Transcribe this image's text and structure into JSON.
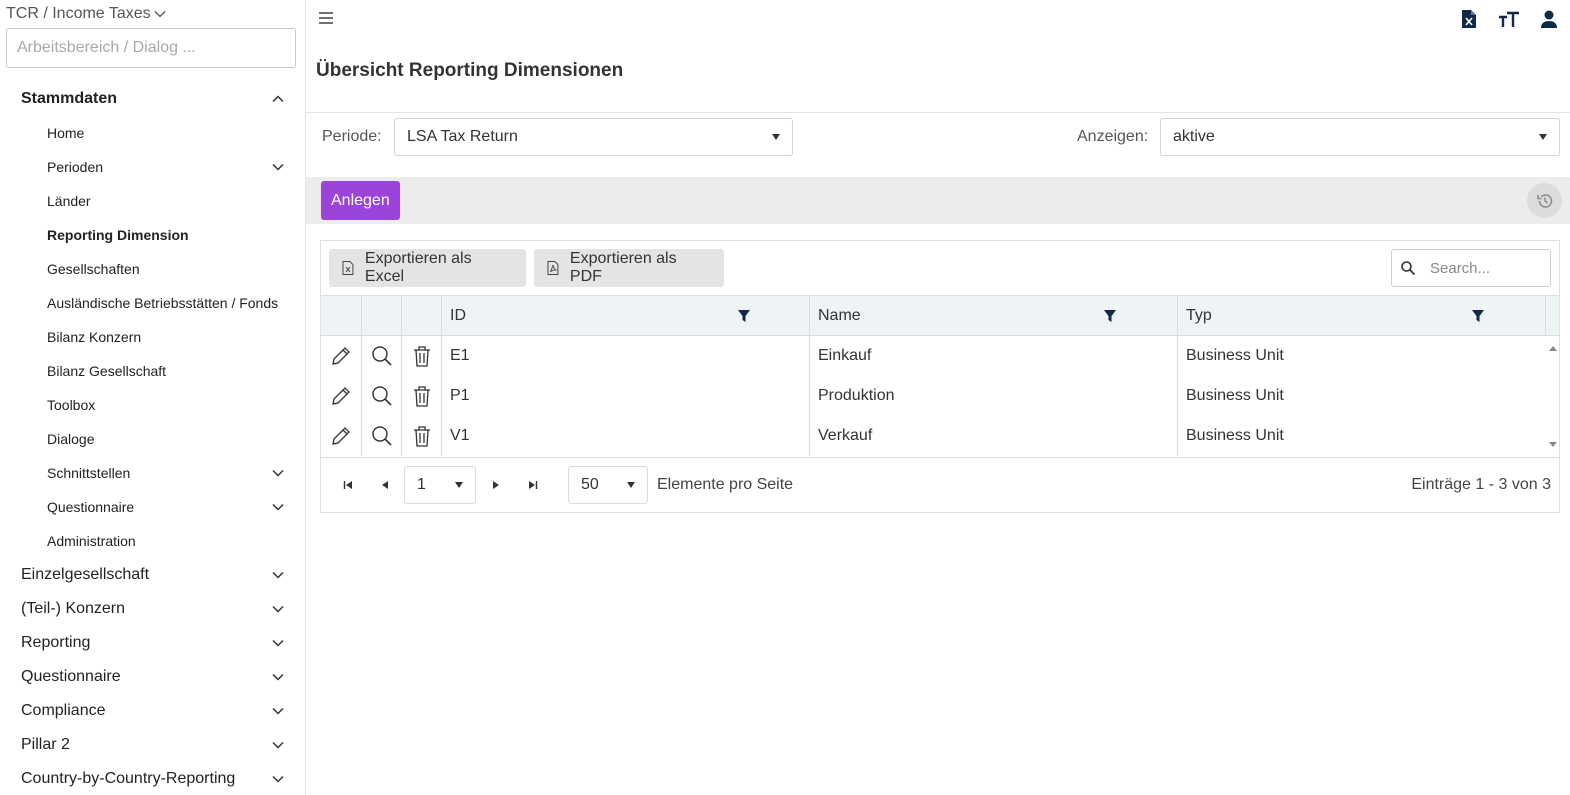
{
  "sidebar": {
    "workspace_title": "TCR / Income Taxes",
    "search_placeholder": "Arbeitsbereich / Dialog ...",
    "section_open": "Stammdaten",
    "sub_items": [
      "Home",
      "Perioden",
      "Länder",
      "Reporting Dimension",
      "Gesellschaften",
      "Ausländische Betriebsstätten / Fonds",
      "Bilanz Konzern",
      "Bilanz Gesellschaft",
      "Toolbox",
      "Dialoge",
      "Schnittstellen",
      "Questionnaire",
      "Administration"
    ],
    "sections": [
      "Einzelgesellschaft",
      "(Teil-) Konzern",
      "Reporting",
      "Questionnaire",
      "Compliance",
      "Pillar 2",
      "Country-by-Country-Reporting"
    ]
  },
  "header": {
    "title": "Übersicht Reporting Dimensionen",
    "icons": [
      "excel-export-icon",
      "font-size-icon",
      "user-icon"
    ]
  },
  "filters": {
    "periode_label": "Periode:",
    "periode_value": "LSA Tax Return",
    "anzeigen_label": "Anzeigen:",
    "anzeigen_value": "aktive"
  },
  "toolbar": {
    "create_label": "Anlegen"
  },
  "grid": {
    "export_excel": "Exportieren als Excel",
    "export_pdf": "Exportieren als PDF",
    "search_placeholder": "Search...",
    "columns": [
      "ID",
      "Name",
      "Typ"
    ],
    "rows": [
      {
        "id": "E1",
        "name": "Einkauf",
        "typ": "Business Unit"
      },
      {
        "id": "P1",
        "name": "Produktion",
        "typ": "Business Unit"
      },
      {
        "id": "V1",
        "name": "Verkauf",
        "typ": "Business Unit"
      }
    ]
  },
  "pager": {
    "page": "1",
    "page_size": "50",
    "page_size_label": "Elemente pro Seite",
    "summary": "Einträge 1 - 3 von 3"
  },
  "colors": {
    "accent": "#9b44d9",
    "header_bg": "#eef3f5",
    "toolbar_bg": "#ececec"
  }
}
